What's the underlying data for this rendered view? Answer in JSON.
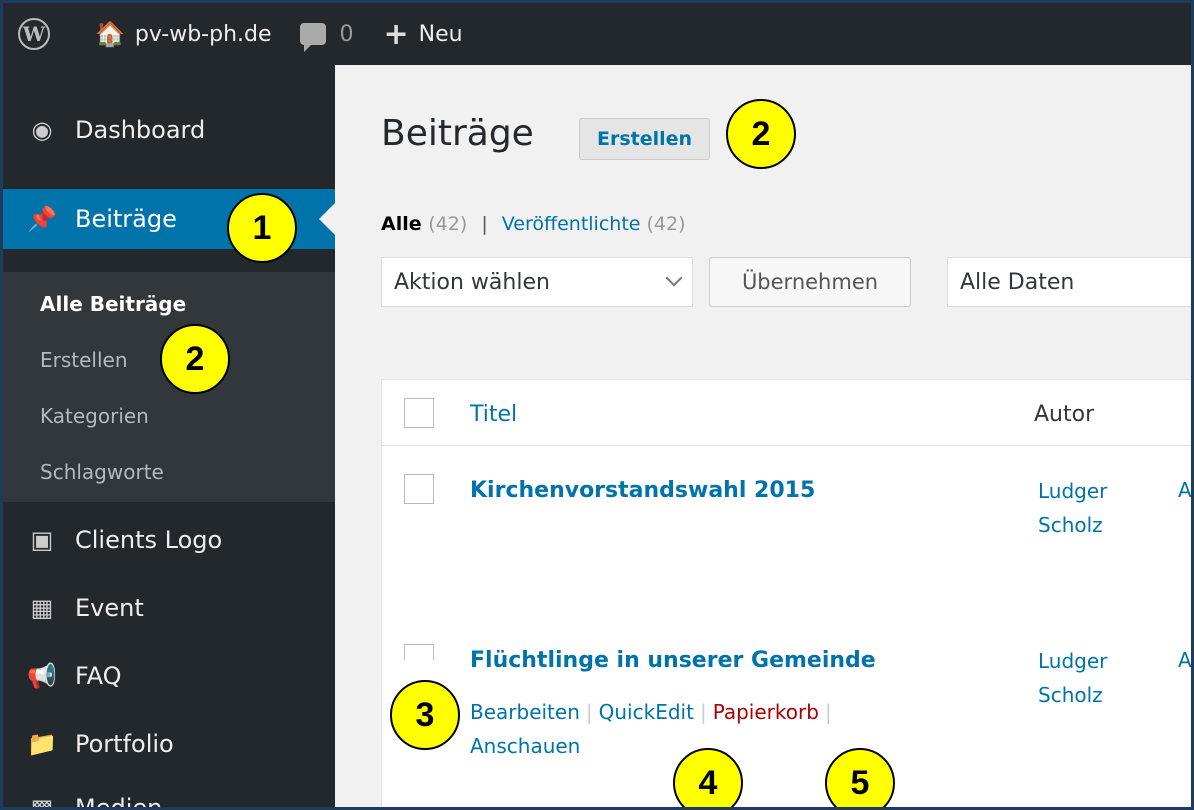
{
  "adminbar": {
    "site_name": "pv-wb-ph.de",
    "comments_count": "0",
    "new_label": "Neu"
  },
  "sidebar": {
    "items": [
      {
        "label": "Dashboard",
        "icon": "dashboard-icon"
      },
      {
        "label": "Beiträge",
        "icon": "pin-icon",
        "active": true
      },
      {
        "label": "Clients Logo",
        "icon": "images-icon"
      },
      {
        "label": "Event",
        "icon": "calendar-icon"
      },
      {
        "label": "FAQ",
        "icon": "megaphone-icon"
      },
      {
        "label": "Portfolio",
        "icon": "folder-icon"
      },
      {
        "label": "Medien",
        "icon": "media-icon"
      }
    ],
    "submenu": [
      "Alle Beiträge",
      "Erstellen",
      "Kategorien",
      "Schlagworte"
    ]
  },
  "main": {
    "title": "Beiträge",
    "add_new": "Erstellen",
    "filters": {
      "all": "Alle",
      "all_count": "(42)",
      "separator": "|",
      "published": "Veröffentlichte",
      "published_count": "(42)"
    },
    "bulk_action": "Aktion wählen",
    "apply": "Übernehmen",
    "dates": "Alle Daten",
    "table": {
      "col_title": "Titel",
      "col_author": "Autor",
      "rows": [
        {
          "title": "Kirchenvorstandswahl 2015",
          "author_first": "Ludger",
          "author_last": "Scholz"
        },
        {
          "title": "Flüchtlinge in unserer Gemeinde",
          "author_first": "Ludger",
          "author_last": "Scholz",
          "actions": {
            "edit": "Bearbeiten",
            "quick": "QuickEdit",
            "trash": "Papierkorb",
            "view": "Anschauen"
          }
        }
      ]
    }
  },
  "callouts": [
    "1",
    "2",
    "2",
    "3",
    "4",
    "5"
  ],
  "colors": {
    "accent": "#0073aa",
    "adminbar": "#23282d",
    "submenu": "#32373c",
    "trash": "#aa0000",
    "callout": "#ffff00"
  }
}
